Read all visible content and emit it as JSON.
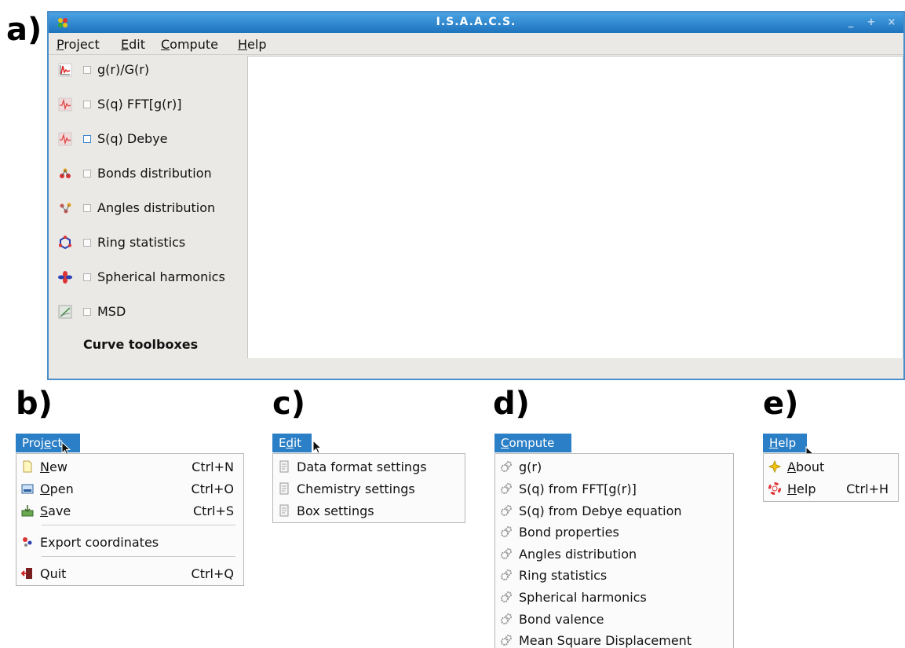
{
  "labels": {
    "a": "a)",
    "b": "b)",
    "c": "c)",
    "d": "d)",
    "e": "e)"
  },
  "window": {
    "title": "I.S.A.A.C.S.",
    "buttons": [
      "_",
      "+",
      "×"
    ],
    "menubar": [
      {
        "first": "P",
        "rest": "roject"
      },
      {
        "first": "E",
        "rest": "dit"
      },
      {
        "first": "C",
        "rest": "ompute"
      },
      {
        "first": "H",
        "rest": "elp"
      }
    ],
    "sidebar": [
      {
        "label": "g(r)/G(r)",
        "icon": "plot-red-icon"
      },
      {
        "label": "S(q) FFT[g(r)]",
        "icon": "plot-pink-icon"
      },
      {
        "label": "S(q) Debye",
        "icon": "plot-pink-icon"
      },
      {
        "label": "Bonds distribution",
        "icon": "bonds-icon"
      },
      {
        "label": "Angles distribution",
        "icon": "angles-icon"
      },
      {
        "label": "Ring statistics",
        "icon": "ring-icon"
      },
      {
        "label": "Spherical harmonics",
        "icon": "harmonics-icon"
      },
      {
        "label": "MSD",
        "icon": "msd-icon"
      }
    ],
    "toolbox_title": "Curve toolboxes"
  },
  "project_menu": {
    "title_first": "Proj",
    "title_u": "e",
    "title_rest": "ct",
    "items": [
      {
        "u": "N",
        "rest": "ew",
        "shortcut": "Ctrl+N",
        "icon": "new-file-icon"
      },
      {
        "u": "O",
        "rest": "pen",
        "shortcut": "Ctrl+O",
        "icon": "open-icon"
      },
      {
        "u": "S",
        "rest": "ave",
        "shortcut": "Ctrl+S",
        "icon": "save-icon"
      },
      {
        "u": "",
        "rest": "Export coordinates",
        "shortcut": "",
        "icon": "export-icon"
      },
      {
        "u": "",
        "rest": "Quit",
        "shortcut": "Ctrl+Q",
        "icon": "quit-icon"
      }
    ]
  },
  "edit_menu": {
    "title_first": "E",
    "title_u": "d",
    "title_rest": "it",
    "items": [
      "Data format settings",
      "Chemistry settings",
      "Box settings"
    ]
  },
  "compute_menu": {
    "title_u": "C",
    "title_rest": "ompute",
    "items": [
      "g(r)",
      "S(q) from FFT[g(r)]",
      "S(q) from Debye equation",
      "Bond properties",
      "Angles distribution",
      "Ring statistics",
      "Spherical harmonics",
      "Bond valence",
      "Mean Square Displacement"
    ]
  },
  "help_menu": {
    "title_u": "H",
    "title_rest": "elp",
    "items": [
      {
        "u": "A",
        "rest": "bout",
        "shortcut": "",
        "icon": "about-star-icon"
      },
      {
        "u": "H",
        "rest": "elp",
        "shortcut": "Ctrl+H",
        "icon": "help-lifebuoy-icon"
      }
    ]
  }
}
